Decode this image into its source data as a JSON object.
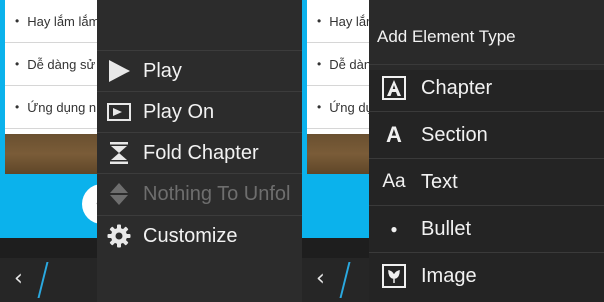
{
  "background": {
    "list_items": [
      {
        "bullet": "•",
        "text": "Hay lắm lắm"
      },
      {
        "bullet": "•",
        "text": "Dễ dàng sử"
      },
      {
        "bullet": "•",
        "text": "Ứng dụng n"
      }
    ],
    "back_glyph": "‹",
    "colors": {
      "accent": "#0bb2ec",
      "slash": "#2aa9e0"
    }
  },
  "context_menu": {
    "items": [
      {
        "label": "Play",
        "icon": "play-icon",
        "enabled": true
      },
      {
        "label": "Play On",
        "icon": "play-on-icon",
        "enabled": true
      },
      {
        "label": "Fold Chapter",
        "icon": "fold-icon",
        "enabled": true
      },
      {
        "label": "Nothing To Unfol",
        "icon": "unfold-icon",
        "enabled": false
      },
      {
        "label": "Customize",
        "icon": "gear-icon",
        "enabled": true
      }
    ]
  },
  "add_menu": {
    "title": "Add Element Type",
    "items": [
      {
        "label": "Chapter",
        "icon": "chapter-icon",
        "glyph": "A"
      },
      {
        "label": "Section",
        "icon": "section-icon",
        "glyph": "A"
      },
      {
        "label": "Text",
        "icon": "text-icon",
        "glyph": "Aa"
      },
      {
        "label": "Bullet",
        "icon": "bullet-icon",
        "glyph": "●"
      },
      {
        "label": "Image",
        "icon": "image-icon",
        "glyph": ""
      }
    ]
  }
}
